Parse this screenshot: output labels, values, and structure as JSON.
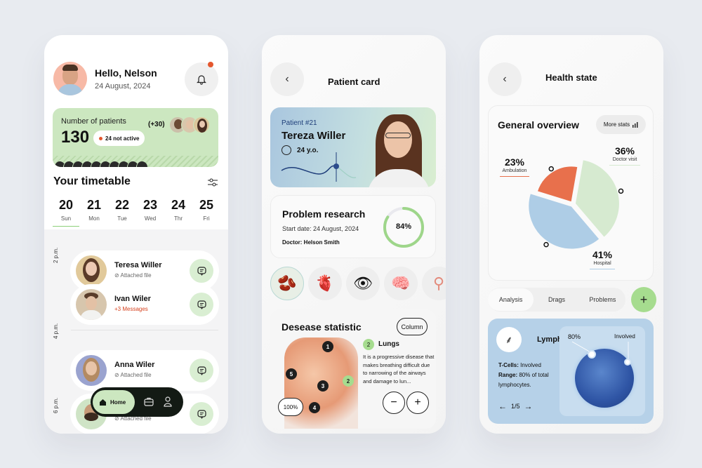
{
  "home": {
    "greeting": "Hello, Nelson",
    "date": "24 August, 2024",
    "notification_badge": true,
    "patients_card": {
      "label": "Number of patients",
      "count": "130",
      "inactive_badge": "24 not active",
      "extra_count": "(+30)",
      "accent": "#cce7c0",
      "status_color": "#e4572e"
    },
    "timetable": {
      "title": "Your timetable",
      "days": [
        {
          "num": "20",
          "name": "Sun",
          "active": true
        },
        {
          "num": "21",
          "name": "Mon"
        },
        {
          "num": "22",
          "name": "Tue"
        },
        {
          "num": "23",
          "name": "Wed"
        },
        {
          "num": "24",
          "name": "Thr"
        },
        {
          "num": "25",
          "name": "Fri"
        }
      ],
      "time_labels": [
        "2 p.m.",
        "4 p.m.",
        "6 p.m."
      ],
      "appointments": [
        {
          "name": "Teresa Willer",
          "sub": "Attached file",
          "sub_type": "file"
        },
        {
          "name": "Ivan Wiler",
          "sub": "+3 Messages",
          "sub_type": "messages"
        },
        {
          "name": "Anna Wiler",
          "sub": "Attached file",
          "sub_type": "file"
        },
        {
          "name": "",
          "sub": "Attached file",
          "sub_type": "file"
        }
      ]
    },
    "nav": {
      "home_label": "Home",
      "items": [
        "home-icon",
        "briefcase-icon",
        "profile-icon"
      ]
    }
  },
  "patient": {
    "header": "Patient card",
    "patient_number": "Patient #21",
    "name": "Tereza Willer",
    "age": "24 y.o.",
    "research": {
      "title": "Problem research",
      "start_date": "Start date: 24 August, 2024",
      "doctor": "Doctor: Helson Smith",
      "progress_label": "84%",
      "progress": 0.84
    },
    "organs": [
      "kidneys",
      "heart",
      "eye",
      "brain",
      "uterus"
    ],
    "organ_glyphs": [
      "🫘",
      "🫀",
      "👁",
      "🧠",
      "⚲"
    ],
    "disease": {
      "title": "Desease statistic",
      "view_button": "Column",
      "zoom": "100%",
      "markers": [
        "1",
        "2",
        "3",
        "4",
        "5"
      ],
      "selected_number": "2",
      "selected_title": "Lungs",
      "description": "It is a progressive disease that makes breathing difficult due to narrowing of the airways and damage to lun...",
      "minus": "−",
      "plus": "+"
    }
  },
  "health": {
    "header": "Health state",
    "overview_title": "General overview",
    "more_stats": "More stats",
    "chart_data": {
      "type": "pie",
      "title": "General overview",
      "slices": [
        {
          "label": "Doctor visit",
          "value": 36,
          "color": "#d6ead0",
          "display": "36%"
        },
        {
          "label": "Hospital",
          "value": 41,
          "color": "#aecde6",
          "display": "41%"
        },
        {
          "label": "Ambulation",
          "value": 23,
          "color": "#e8704c",
          "display": "23%"
        }
      ]
    },
    "tabs": [
      "Analysis",
      "Drags",
      "Problems"
    ],
    "active_tab": "Analysis",
    "add_label": "+",
    "lymph": {
      "title": "Lymph",
      "tcells_label": "T-Cells:",
      "tcells_value": " Involved",
      "range_label": "Range:",
      "range_value": " 80% of total lymphocytes.",
      "pager": "1/5",
      "viz_percent": "80%",
      "viz_status": "Involved"
    }
  }
}
